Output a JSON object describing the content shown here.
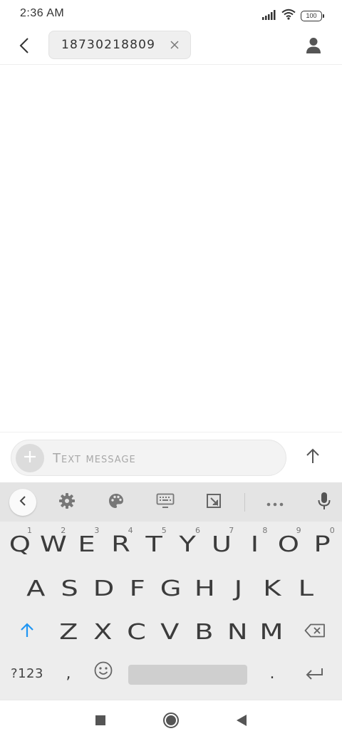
{
  "status_bar": {
    "time": "2:36 AM",
    "battery": "100"
  },
  "header": {
    "recipient": "18730218809"
  },
  "composer": {
    "placeholder": "Text message"
  },
  "keyboard": {
    "row1": [
      {
        "label": "Q",
        "hint": "1"
      },
      {
        "label": "W",
        "hint": "2"
      },
      {
        "label": "E",
        "hint": "3"
      },
      {
        "label": "R",
        "hint": "4"
      },
      {
        "label": "T",
        "hint": "5"
      },
      {
        "label": "Y",
        "hint": "6"
      },
      {
        "label": "U",
        "hint": "7"
      },
      {
        "label": "I",
        "hint": "8"
      },
      {
        "label": "O",
        "hint": "9"
      },
      {
        "label": "P",
        "hint": "0"
      }
    ],
    "row2": [
      "A",
      "S",
      "D",
      "F",
      "G",
      "H",
      "J",
      "K",
      "L"
    ],
    "row3": [
      "Z",
      "X",
      "C",
      "V",
      "B",
      "N",
      "M"
    ],
    "symbols_label": "?123",
    "comma": ",",
    "period": "."
  },
  "icons": {
    "back": "back-arrow-icon",
    "chip_close": "close-icon",
    "contact": "person-icon",
    "attach": "plus-icon",
    "send": "arrow-up-icon",
    "toolbar": [
      "chevron-left-icon",
      "gear-icon",
      "palette-icon",
      "keyboard-icon",
      "resize-icon",
      "more-icon",
      "microphone-icon"
    ],
    "shift": "shift-arrow-icon",
    "backspace": "backspace-icon",
    "emoji": "emoji-icon",
    "enter": "enter-icon",
    "nav": [
      "square-icon",
      "circle-icon",
      "triangle-back-icon"
    ]
  },
  "colors": {
    "accent": "#2196f3",
    "keyboard_bg": "#ededed",
    "toolbar_bg": "#e4e4e4"
  }
}
